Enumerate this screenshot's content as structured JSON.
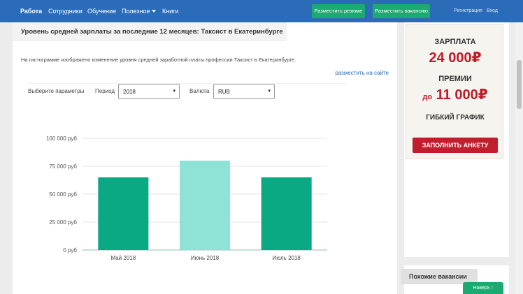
{
  "nav": {
    "items": [
      {
        "label": "Работа",
        "active": true
      },
      {
        "label": "Сотрудники"
      },
      {
        "label": "Обучение"
      },
      {
        "label": "Полезное"
      },
      {
        "label": "Книги"
      }
    ],
    "post_resume_label": "Разместить резюме",
    "post_vacancy_label": "Разместить вакансию",
    "register_label": "Регистрация",
    "login_label": "Вход",
    "bar_color": "#2b6cb8",
    "button_color": "#1aaa72"
  },
  "main": {
    "title": "Уровень средней зарплаты за последние 12 месяцев: Таксист в Екатеринбурге",
    "description": "На гистограмме изображено изменение уровня средней заработной платы профессии Таксист в Екатеринбурге.",
    "place_link": "разместить на сайте",
    "params": {
      "label": "Выберите параметры",
      "period_label": "Период",
      "period_value": "2018",
      "currency_label": "Валюта",
      "currency_value": "RUB",
      "caret": "▾"
    }
  },
  "chart_data": {
    "type": "bar",
    "categories": [
      "Май 2018",
      "Июнь 2018",
      "Июль 2018"
    ],
    "values": [
      65000,
      80000,
      65000
    ],
    "colors": [
      "#0aa883",
      "#8ee3d6",
      "#0aa883"
    ],
    "ylim": [
      0,
      100000
    ],
    "yticks": [
      {
        "value": 0,
        "label": "0 руб"
      },
      {
        "value": 25000,
        "label": "25 000 руб"
      },
      {
        "value": 50000,
        "label": "50 000 руб"
      },
      {
        "value": 75000,
        "label": "75 000 руб"
      },
      {
        "value": 100000,
        "label": "100 000 руб"
      }
    ],
    "grid": true
  },
  "ad": {
    "line1": "ЗАРПЛАТА",
    "line2": "24 000₽",
    "line3": "ПРЕМИИ",
    "line4_prefix": "до",
    "line4": "11 000₽",
    "line5": "ГИБКИЙ ГРАФИК",
    "button": "ЗАПОЛНИТЬ АНКЕТУ",
    "accent_color": "#c21d2d"
  },
  "sidebar": {
    "similar_title": "Похожие вакансии",
    "up_button_label": "Наверх",
    "up_icon": "arrow-up-icon"
  }
}
